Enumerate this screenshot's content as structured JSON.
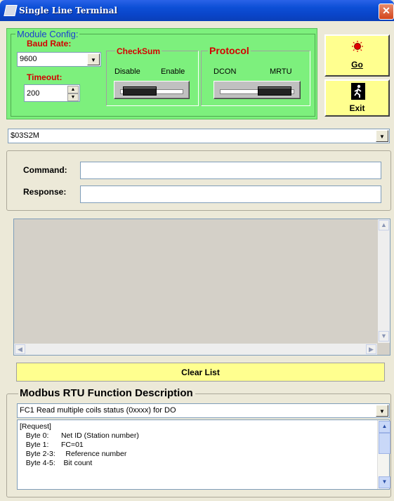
{
  "window": {
    "title": "Single Line Terminal",
    "close_glyph": "✕"
  },
  "module_config": {
    "legend": "Module Config:",
    "baud_rate": {
      "label": "Baud Rate:",
      "value": "9600"
    },
    "timeout": {
      "label": "Timeout:",
      "value": "200"
    },
    "checksum": {
      "label": "CheckSum",
      "opt_off": "Disable",
      "opt_on": "Enable",
      "state": "Disable"
    },
    "protocol": {
      "label": "Protocol",
      "opt_a": "DCON",
      "opt_b": "MRTU",
      "state": "MRTU"
    }
  },
  "buttons": {
    "go": "Go",
    "exit": "Exit",
    "clear_list": "Clear List"
  },
  "command_combo": {
    "value": "$03S2M"
  },
  "command": {
    "label": "Command:",
    "value": ""
  },
  "response": {
    "label": "Response:",
    "value": ""
  },
  "modbus": {
    "heading": "Modbus RTU Function Description",
    "selected_function": "FC1  Read multiple coils status (0xxxx)  for DO",
    "description": "[Request]\n   Byte 0:      Net ID (Station number)\n   Byte 1:      FC=01\n   Byte 2-3:     Reference number\n   Byte 4-5:    Bit count"
  },
  "icons": {
    "go": "red-light-icon",
    "exit": "running-man-icon"
  },
  "colors": {
    "config_panel": "#7df07d",
    "button_yellow": "#ffff8f",
    "label_red": "#d40000"
  }
}
